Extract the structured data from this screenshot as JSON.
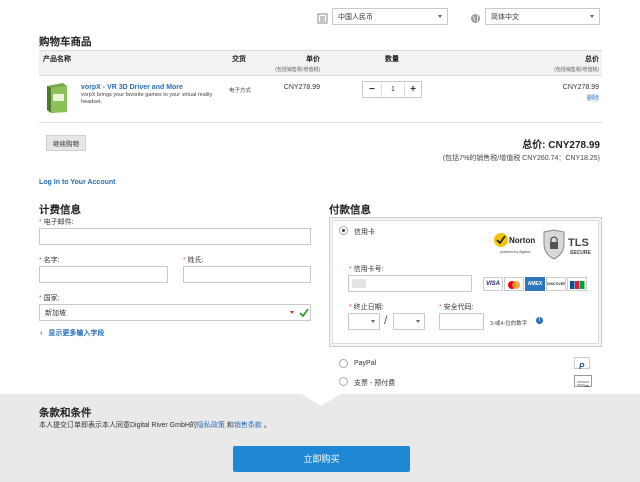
{
  "top": {
    "currency": "中国人民币",
    "language": "简体中文"
  },
  "cart": {
    "title": "购物车商品",
    "headers": {
      "product": "产品名称",
      "delivery": "交货",
      "unit_price": "单价",
      "unit_price_note": "(包括销售税/增值税)",
      "quantity": "数量",
      "total": "总价",
      "total_note": "(包括销售税/增值税)"
    },
    "item": {
      "name": "vorpX - VR 3D Driver and More",
      "description": "vorpX brings your favorite games to your virtual reality headset.",
      "delivery": "电子方式",
      "price": "CNY278.99",
      "quantity": "1",
      "total": "CNY278.99",
      "remove": "删除"
    },
    "continue": "继续购物",
    "grand_total": "总价:  CNY278.99",
    "tax_note": "(包括7%的销售税/增值税 CNY260.74：CNY18.25)"
  },
  "login_link": "Log In to Your Account",
  "billing": {
    "title": "计费信息",
    "email_label": "电子邮件:",
    "first_name_label": "名字:",
    "last_name_label": "姓氏:",
    "country_label": "国家:",
    "country_value": "新加坡",
    "more_fields": "显示更多输入字段"
  },
  "payment": {
    "title": "付款信息",
    "credit_card": "信用卡",
    "card_number_label": "信用卡号:",
    "expiry_label": "终止日期:",
    "security_label": "安全代码:",
    "security_hint": "3-或4-位的数字",
    "norton": "Norton",
    "norton_sub": "powered by digicert",
    "tls": "TLS",
    "tls_sub": "SECURE",
    "cards": [
      "VISA",
      "MC",
      "AMEX",
      "DISCOVER",
      "JCB"
    ],
    "paypal": "PayPal",
    "check": "支票 - 预付费"
  },
  "terms": {
    "title": "条款和条件",
    "text_before": "本人提交订单即表示本人同意Digital River GmbH的",
    "privacy": "隐私政策",
    "and": "和",
    "sales_terms": "销售条款",
    "period": "。"
  },
  "buy_button": "立即购买",
  "colors": {
    "link": "#2a6ebb",
    "button": "#1e88d4",
    "required": "#d9534f",
    "check": "#2e9e2e"
  }
}
